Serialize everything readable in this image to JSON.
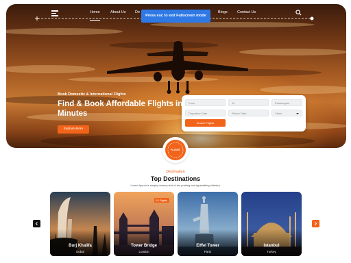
{
  "nav": {
    "links": [
      "Home",
      "About Us",
      "De",
      "Blogs",
      "Contact Us"
    ]
  },
  "toast": {
    "text": "Press esc to exit Fullscreen mode"
  },
  "hero": {
    "subtitle": "Book Domestic & International Flights",
    "title": "Find & Book Affordable Flights in Minutes",
    "explore_label": "Explore More"
  },
  "search_form": {
    "from_placeholder": "From",
    "to_placeholder": "To",
    "passengers_placeholder": "Passengers",
    "departure_placeholder": "Departure Date",
    "return_placeholder": "Return Date",
    "class_placeholder": "Class",
    "submit_label": "Search Flights"
  },
  "badge": {
    "text": "FLIGHT"
  },
  "destinations": {
    "label": "Destination",
    "title": "Top Destinations",
    "description": "Lorem Ipsum is simply dummy text of the printing and typesetting industry.",
    "cards": [
      {
        "name": "Burj Khalifa",
        "place": "Dubai",
        "tag": ""
      },
      {
        "name": "Tower Bridge",
        "place": "London",
        "tag": "10 Flights"
      },
      {
        "name": "Eiffel Tower",
        "place": "Paris",
        "tag": ""
      },
      {
        "name": "Istanbul",
        "place": "Turkey",
        "tag": ""
      }
    ]
  },
  "colors": {
    "accent": "#f2641a",
    "toast": "#2f79e6"
  },
  "icons": [
    "menu-icon",
    "search-icon",
    "chevron-left-icon",
    "chevron-right-icon",
    "airplane-icon"
  ]
}
